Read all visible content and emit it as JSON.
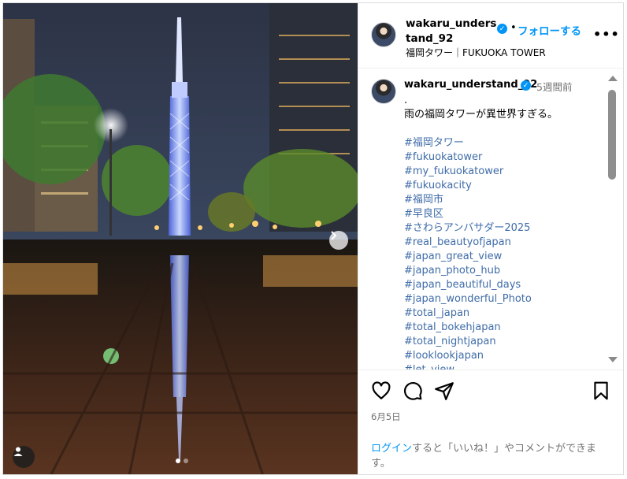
{
  "header": {
    "username": "wakaru_understand_92",
    "verified_icon": "verified-badge-icon",
    "separator": "•",
    "follow_label": "フォローする",
    "more_icon": "more-options-icon",
    "location": "福岡タワー｜FUKUOKA TOWER"
  },
  "post": {
    "slide_count": 2,
    "current_slide": 1,
    "next_icon": "chevron-right-icon",
    "user_tag_icon": "person-icon"
  },
  "caption": {
    "username": "wakaru_understand_92",
    "time": "5週間前",
    "lines": [
      {
        "text": ".",
        "hashtag": false
      },
      {
        "text": "雨の福岡タワーが異世界すぎる。",
        "hashtag": false
      },
      {
        "text": "",
        "hashtag": false
      },
      {
        "text": "#福岡タワー",
        "hashtag": true
      },
      {
        "text": "#fukuokatower",
        "hashtag": true
      },
      {
        "text": "#my_fukuokatower",
        "hashtag": true
      },
      {
        "text": "#fukuokacity",
        "hashtag": true
      },
      {
        "text": "#福岡市",
        "hashtag": true
      },
      {
        "text": "#早良区",
        "hashtag": true
      },
      {
        "text": "#さわらアンバサダー2025",
        "hashtag": true
      },
      {
        "text": "#real_beautyofjapan",
        "hashtag": true
      },
      {
        "text": "#japan_great_view",
        "hashtag": true
      },
      {
        "text": "#japan_photo_hub",
        "hashtag": true
      },
      {
        "text": "#japan_beautiful_days",
        "hashtag": true
      },
      {
        "text": "#japan_wonderful_Photo",
        "hashtag": true
      },
      {
        "text": "#total_japan",
        "hashtag": true
      },
      {
        "text": "#total_bokehjapan",
        "hashtag": true
      },
      {
        "text": "#total_nightjapan",
        "hashtag": true
      },
      {
        "text": "#looklookjapan",
        "hashtag": true
      },
      {
        "text": "#let_view",
        "hashtag": true
      }
    ]
  },
  "actions": {
    "like_icon": "heart-icon",
    "comment_icon": "comment-icon",
    "share_icon": "share-icon",
    "save_icon": "bookmark-icon",
    "date": "6月5日"
  },
  "login_prompt": {
    "link": "ログイン",
    "text": "すると「いいね！」やコメントができます。"
  },
  "colors": {
    "accent": "#0095f6",
    "hashtag": "#3f6ca8",
    "muted": "#737373"
  }
}
